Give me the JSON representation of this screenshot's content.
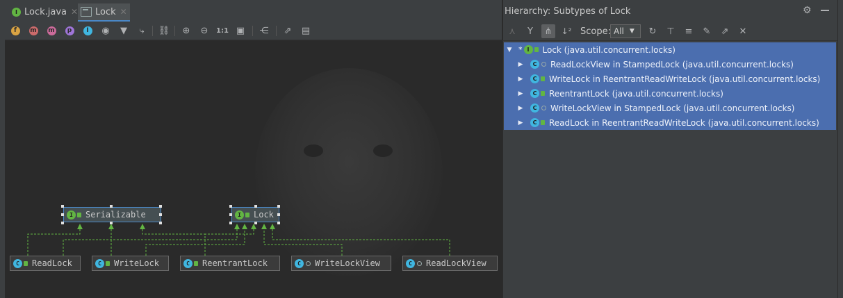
{
  "editor_tabs": [
    {
      "label": "Lock.java",
      "icon": "interface-icon",
      "active": false
    },
    {
      "label": "Lock",
      "icon": "diagram-icon",
      "active": true
    }
  ],
  "diagram_toolbar": {
    "icons": [
      "fields-filter-icon",
      "constructors-filter-icon",
      "methods-filter-icon",
      "properties-filter-icon",
      "inner-classes-filter-icon",
      "eye-icon",
      "filter-icon",
      "edge-icon",
      "link-icon",
      "zoom-in-icon",
      "zoom-out-icon",
      "actual-size-icon",
      "fit-content-icon",
      "layout-icon",
      "export-icon",
      "print-icon"
    ],
    "actual_size_label": "1:1",
    "filter_letters": {
      "fields": "f",
      "constructors": "m",
      "methods": "m",
      "properties": "p",
      "inner": "I"
    }
  },
  "diagram": {
    "nodes": [
      {
        "id": "serializable",
        "label": "Serializable",
        "kind": "interface"
      },
      {
        "id": "lock",
        "label": "Lock",
        "kind": "interface"
      },
      {
        "id": "readlock",
        "label": "ReadLock",
        "kind": "class"
      },
      {
        "id": "writelock",
        "label": "WriteLock",
        "kind": "class"
      },
      {
        "id": "reentrantlock",
        "label": "ReentrantLock",
        "kind": "class"
      },
      {
        "id": "writelockview",
        "label": "WriteLockView",
        "kind": "class"
      },
      {
        "id": "readlockview",
        "label": "ReadLockView",
        "kind": "class"
      }
    ],
    "edge_color": "#62b543"
  },
  "hierarchy": {
    "title": "Hierarchy:  Subtypes of Lock",
    "scope_label": "Scope:",
    "scope_value": "All",
    "toolbar_icons": [
      "supertypes-icon",
      "subtypes-icon",
      "type-hierarchy-icon",
      "sort-alpha-icon",
      "refresh-icon",
      "expand-all-icon",
      "collapse-all-icon",
      "pin-icon",
      "export-icon",
      "close-icon"
    ],
    "header_icons": [
      "gear-icon",
      "minimize-icon"
    ],
    "root": {
      "label": "Lock (java.util.concurrent.locks)",
      "kind": "interface"
    },
    "children": [
      {
        "label": "ReadLockView in StampedLock (java.util.concurrent.locks)"
      },
      {
        "label": "WriteLock in ReentrantReadWriteLock (java.util.concurrent.locks)"
      },
      {
        "label": "ReentrantLock (java.util.concurrent.locks)"
      },
      {
        "label": "WriteLockView in StampedLock (java.util.concurrent.locks)"
      },
      {
        "label": "ReadLock in ReentrantReadWriteLock (java.util.concurrent.locks)"
      }
    ],
    "selection_color": "#4b6eaf"
  },
  "colors": {
    "background": "#2b2b2b",
    "panel": "#3c3f41",
    "interface_icon": "#62b543",
    "class_icon": "#40b6e0"
  }
}
